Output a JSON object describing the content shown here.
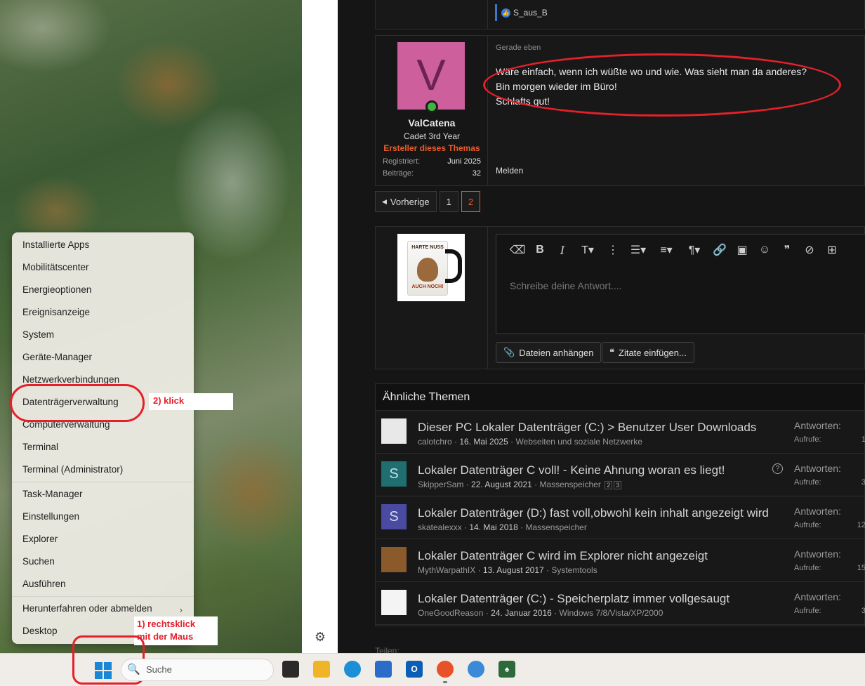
{
  "post_top": {
    "reaction_user": "S_aus_B"
  },
  "post": {
    "avatar_letter": "V",
    "username": "ValCatena",
    "user_title": "Cadet 3rd Year",
    "badge": "Ersteller dieses Themas",
    "registered_label": "Registriert:",
    "registered_value": "Juni 2025",
    "posts_label": "Beiträge:",
    "posts_value": "32",
    "time": "Gerade eben",
    "lines": [
      "Wäre einfach, wenn ich wüßte wo und wie. Was sieht man da anderes?",
      "Bin morgen wieder im Büro!",
      "Schlafts gut!"
    ],
    "report": "Melden"
  },
  "pagination": {
    "prev": "Vorherige",
    "pages": [
      "1",
      "2"
    ],
    "active": "2"
  },
  "mug_text": {
    "top": "HARTE NUSS",
    "bottom": "AUCH NOCH!"
  },
  "reply": {
    "placeholder": "Schreibe deine Antwort....",
    "attach": "Dateien anhängen",
    "quotes": "Zitate einfügen..."
  },
  "similar": {
    "heading": "Ähnliche Themen",
    "replies_label": "Antworten:",
    "views_label": "Aufrufe:",
    "threads": [
      {
        "title": "Dieser PC Lokaler Datenträger (C:) > Benutzer User Downloads",
        "author": "calotchro",
        "date": "16. Mai 2025",
        "forum": "Webseiten und soziale Netzwerke",
        "views_trunc": "1",
        "avatar_color": "#e8e8e8",
        "avatar_letter": ""
      },
      {
        "title": "Lokaler Datenträger C voll! - Keine Ahnung woran es liegt!",
        "author": "SkipperSam",
        "date": "22. August 2021",
        "forum": "Massenspeicher",
        "pages": [
          "2",
          "3"
        ],
        "views_trunc": "3",
        "avatar_color": "#1f6e70",
        "avatar_letter": "S"
      },
      {
        "title": "Lokaler Datenträger (D:) fast voll,obwohl kein inhalt angezeigt wird",
        "author": "skatealexxx",
        "date": "14. Mai 2018",
        "forum": "Massenspeicher",
        "views_trunc": "12",
        "avatar_color": "#4a4aa0",
        "avatar_letter": "S"
      },
      {
        "title": "Lokaler Datenträger C wird im Explorer nicht angezeigt",
        "author": "MythWarpathIX",
        "date": "13. August 2017",
        "forum": "Systemtools",
        "views_trunc": "15",
        "avatar_color": "#8a5a2a",
        "avatar_letter": ""
      },
      {
        "title": "Lokaler Datenträger (C:) - Speicherplatz immer vollgesaugt",
        "author": "OneGoodReason",
        "date": "24. Januar 2016",
        "forum": "Windows 7/8/Vista/XP/2000",
        "views_trunc": "3",
        "avatar_color": "#f4f4f4",
        "avatar_letter": ""
      }
    ]
  },
  "share_label": "Teilen:",
  "winx_menu": {
    "group1": [
      "Installierte Apps",
      "Mobilitätscenter",
      "Energieoptionen",
      "Ereignisanzeige",
      "System",
      "Geräte-Manager",
      "Netzwerkverbindungen",
      "Datenträgerverwaltung",
      "Computerverwaltung",
      "Terminal",
      "Terminal (Administrator)"
    ],
    "group2": [
      "Task-Manager",
      "Einstellungen",
      "Explorer",
      "Suchen",
      "Ausführen"
    ],
    "group3": [
      "Herunterfahren oder abmelden",
      "Desktop"
    ]
  },
  "annotations": {
    "step2": "2) klick",
    "step1_line1": "1) rechtsklick",
    "step1_line2": "mit der Maus",
    "color": "#e5202a"
  },
  "taskbar": {
    "search_placeholder": "Suche"
  }
}
